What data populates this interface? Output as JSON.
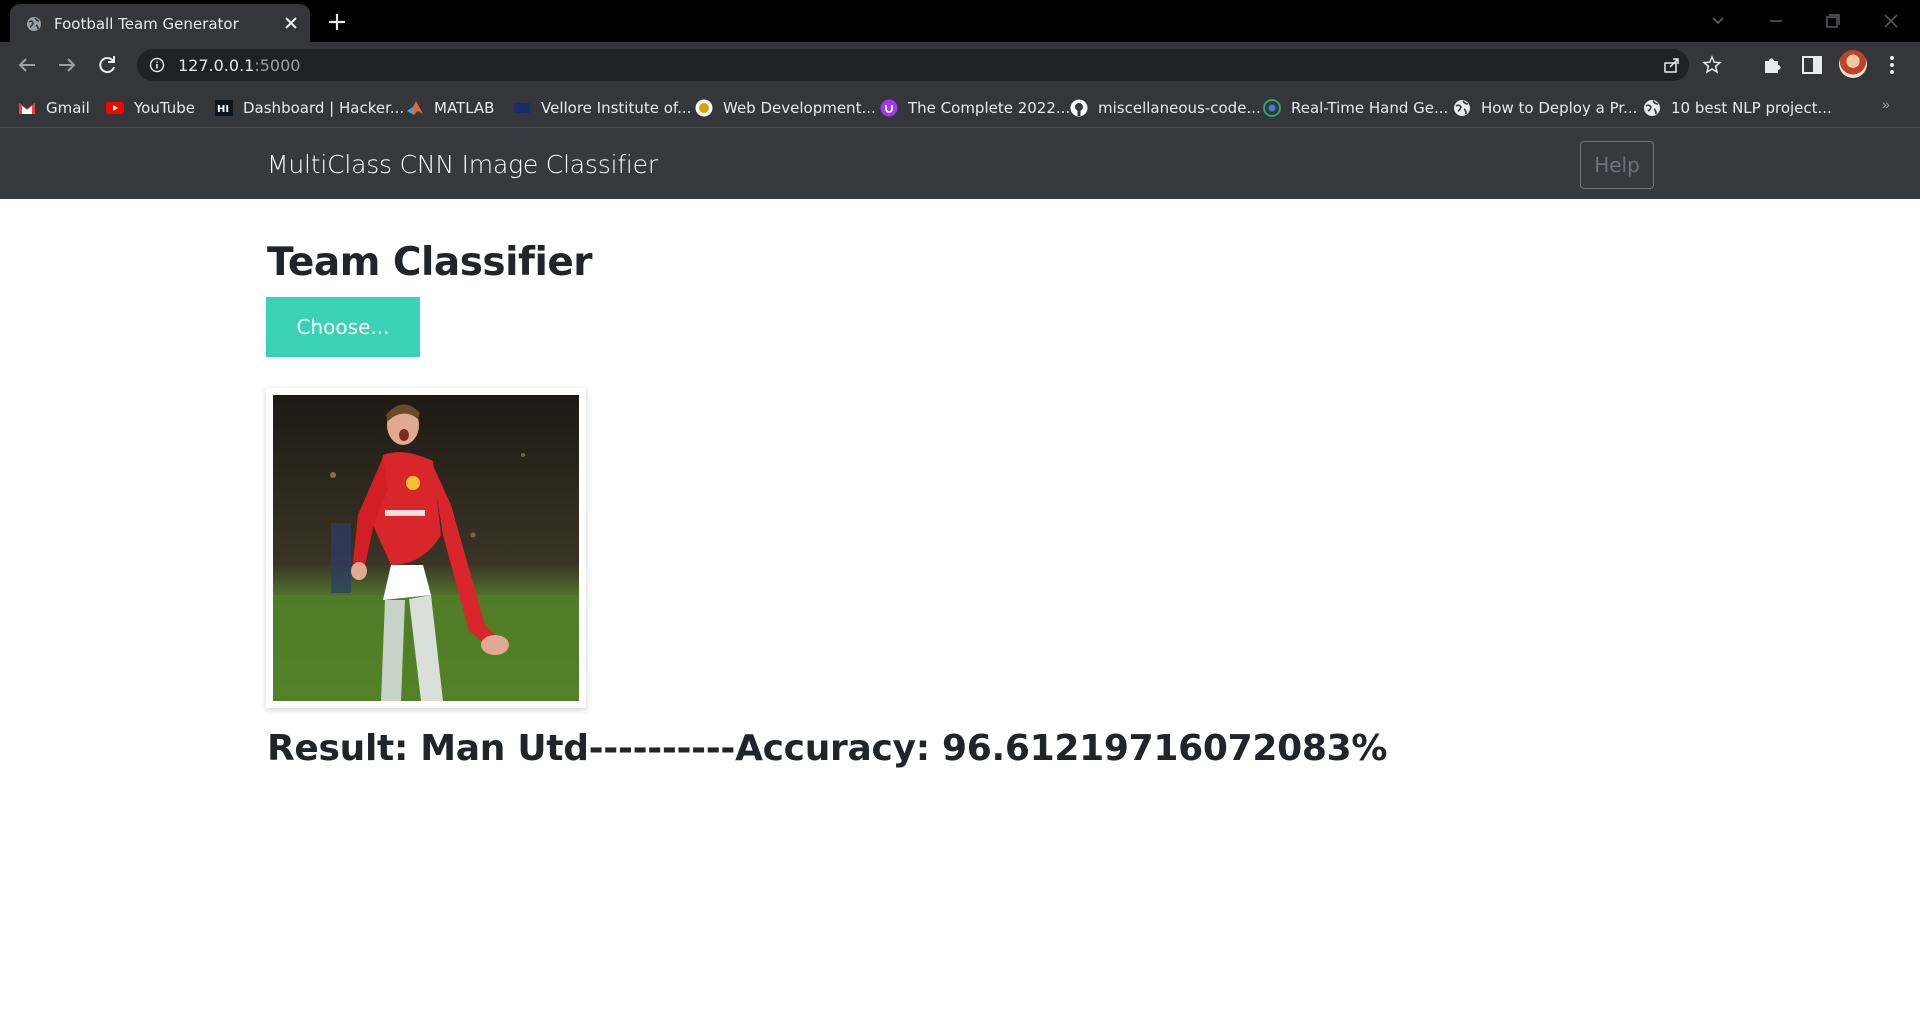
{
  "browser": {
    "tab_title": "Football Team Generator",
    "url_host": "127.0.0.1",
    "url_port": ":5000",
    "bookmarks": [
      {
        "label": "Gmail",
        "icon": "gmail-icon"
      },
      {
        "label": "YouTube",
        "icon": "youtube-icon"
      },
      {
        "label": "Dashboard | Hacker...",
        "icon": "hackerrank-icon"
      },
      {
        "label": "MATLAB",
        "icon": "matlab-icon"
      },
      {
        "label": "Vellore Institute of...",
        "icon": "vit-icon"
      },
      {
        "label": "Web Development...",
        "icon": "udemy-badge-icon"
      },
      {
        "label": "The Complete 2022...",
        "icon": "udemy-icon"
      },
      {
        "label": "miscellaneous-code...",
        "icon": "github-icon"
      },
      {
        "label": "Real-Time Hand Ge...",
        "icon": "site-icon"
      },
      {
        "label": "How to Deploy a Pr...",
        "icon": "globe-icon"
      },
      {
        "label": "10 best NLP project...",
        "icon": "globe-icon"
      }
    ],
    "more_bookmarks": "»"
  },
  "navbar": {
    "brand": "MultiClass CNN Image Classifier",
    "help_label": "Help"
  },
  "main": {
    "title": "Team Classifier",
    "choose_label": "Choose...",
    "result_text": "Result: Man Utd----------Accuracy: 96.61219716072083%"
  },
  "colors": {
    "navbar_bg": "#343a40",
    "choose_btn": "#39d2b4",
    "help_border": "#6c757d"
  }
}
